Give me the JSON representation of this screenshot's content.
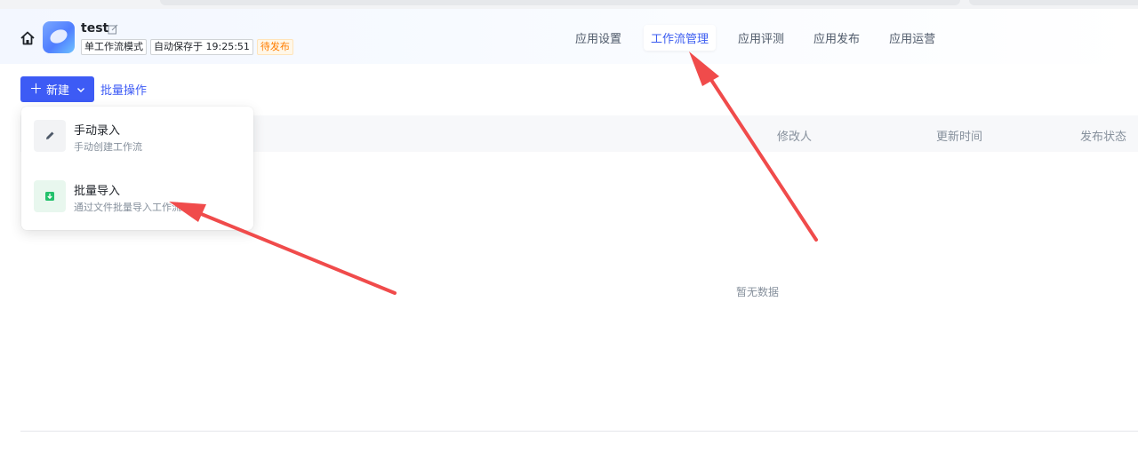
{
  "app": {
    "name": "test",
    "tags": {
      "mode": "单工作流模式",
      "autosave": "自动保存于 19:25:51",
      "status": "待发布"
    }
  },
  "nav": {
    "tabs": [
      {
        "label": "应用设置",
        "active": false
      },
      {
        "label": "工作流管理",
        "active": true
      },
      {
        "label": "应用评测",
        "active": false
      },
      {
        "label": "应用发布",
        "active": false
      },
      {
        "label": "应用运营",
        "active": false
      }
    ]
  },
  "toolbar": {
    "new_label": "新建",
    "batch_label": "批量操作"
  },
  "dropdown": {
    "items": [
      {
        "title": "手动录入",
        "subtitle": "手动创建工作流",
        "icon": "pencil-icon"
      },
      {
        "title": "批量导入",
        "subtitle": "通过文件批量导入工作流",
        "icon": "import-icon"
      }
    ]
  },
  "table": {
    "columns": {
      "modifier": "修改人",
      "updated": "更新时间",
      "status": "发布状态"
    },
    "empty_text": "暂无数据"
  },
  "colors": {
    "primary": "#3d5bf5",
    "annotation_arrow": "#f04b4b",
    "pending_tag": "#ff7d00"
  }
}
